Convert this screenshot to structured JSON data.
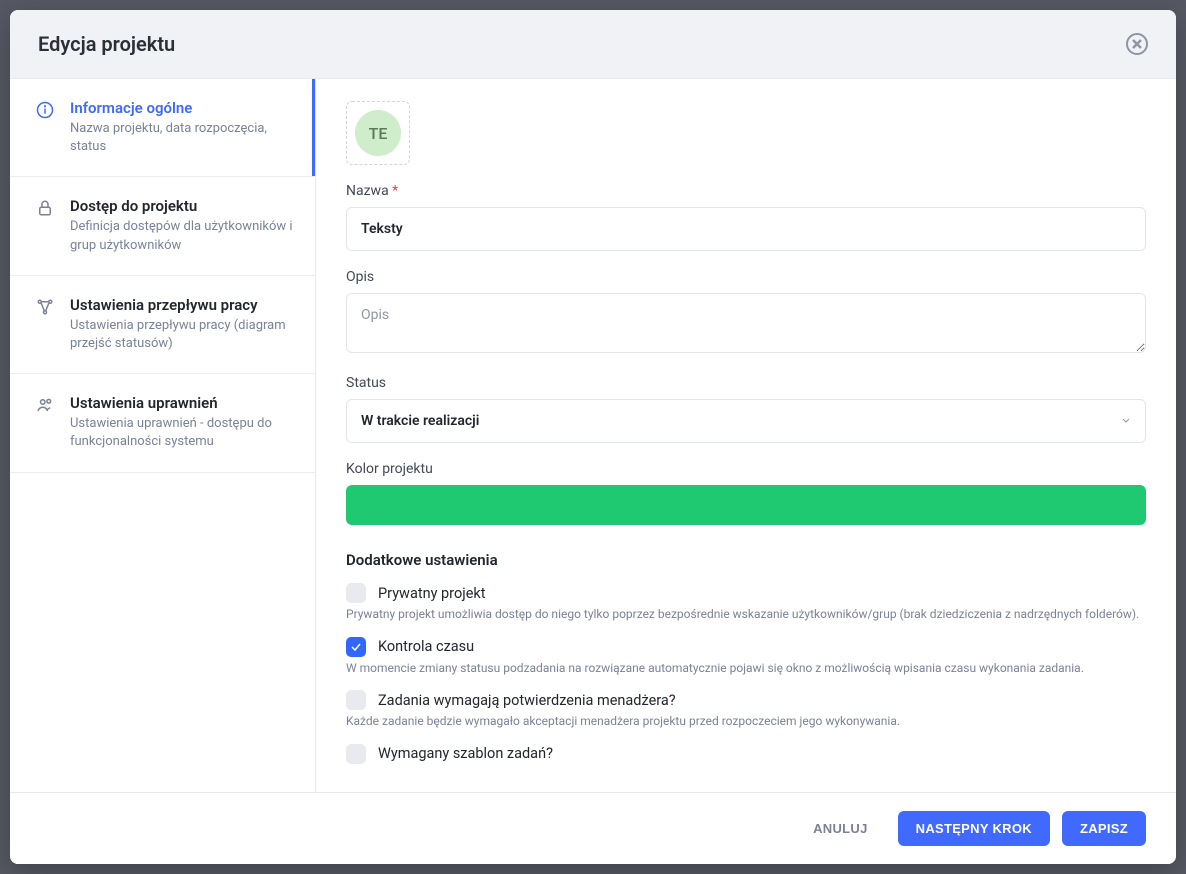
{
  "header": {
    "title": "Edycja projektu"
  },
  "sidebar": {
    "items": [
      {
        "title": "Informacje ogólne",
        "desc": "Nazwa projektu, data rozpoczęcia, status"
      },
      {
        "title": "Dostęp do projektu",
        "desc": "Definicja dostępów dla użytkowników i grup użytkowników"
      },
      {
        "title": "Ustawienia przepływu pracy",
        "desc": "Ustawienia przepływu pracy (diagram przejść statusów)"
      },
      {
        "title": "Ustawienia uprawnień",
        "desc": "Ustawienia uprawnień - dostępu do funkcjonalności systemu"
      }
    ]
  },
  "form": {
    "avatar_initials": "TE",
    "name_label": "Nazwa",
    "name_value": "Teksty",
    "desc_label": "Opis",
    "desc_placeholder": "Opis",
    "status_label": "Status",
    "status_value": "W trakcie realizacji",
    "color_label": "Kolor projektu",
    "color_value": "#1fc971",
    "additional_heading": "Dodatkowe ustawienia",
    "checks": [
      {
        "label": "Prywatny projekt",
        "checked": false,
        "hint": "Prywatny projekt umożliwia dostęp do niego tylko poprzez bezpośrednie wskazanie użytkowników/grup (brak dziedziczenia z nadrzędnych folderów)."
      },
      {
        "label": "Kontrola czasu",
        "checked": true,
        "hint": "W momencie zmiany statusu podzadania na rozwiązane automatycznie pojawi się okno z możliwością wpisania czasu wykonania zadania."
      },
      {
        "label": "Zadania wymagają potwierdzenia menadżera?",
        "checked": false,
        "hint": "Każde zadanie będzie wymagało akceptacji menadżera projektu przed rozpoczeciem jego wykonywania."
      },
      {
        "label": "Wymagany szablon zadań?",
        "checked": false,
        "hint": ""
      }
    ]
  },
  "footer": {
    "cancel": "ANULUJ",
    "next": "NASTĘPNY KROK",
    "save": "ZAPISZ"
  }
}
